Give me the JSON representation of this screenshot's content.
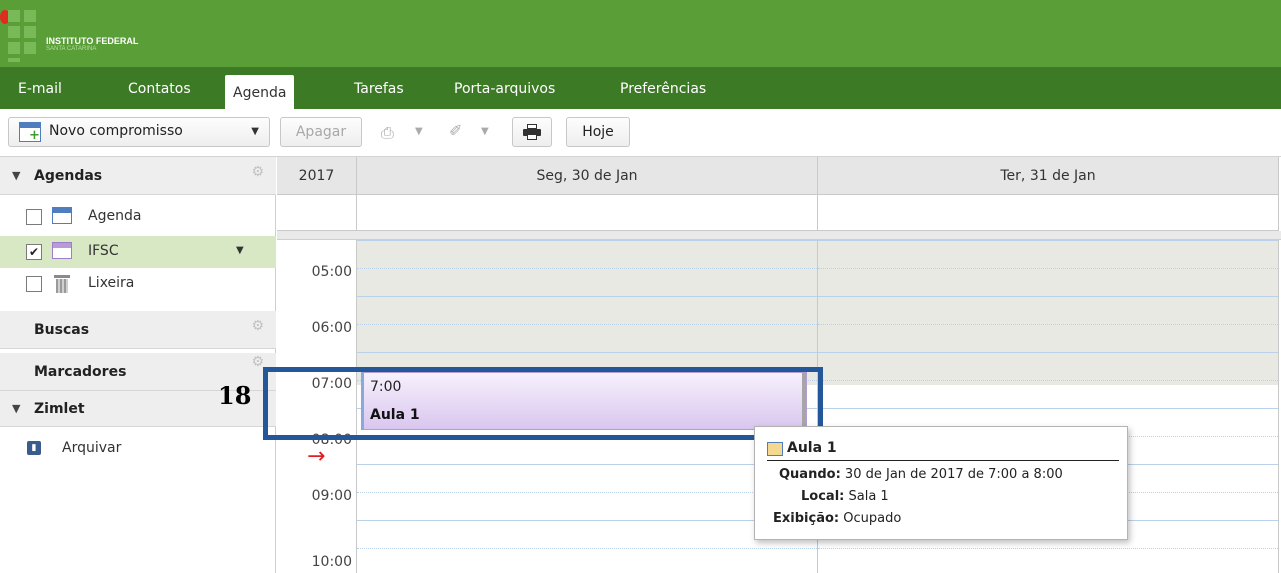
{
  "header": {
    "logo_title": "INSTITUTO FEDERAL",
    "logo_subtitle": "SANTA CATARINA",
    "brand_color": "#5a9e38"
  },
  "tabs": [
    {
      "label": "E-mail"
    },
    {
      "label": "Contatos"
    },
    {
      "label": "Agenda",
      "active": true
    },
    {
      "label": "Tarefas"
    },
    {
      "label": "Porta-arquivos"
    },
    {
      "label": "Preferências"
    }
  ],
  "toolbar": {
    "new_appointment": "Novo compromisso",
    "delete": "Apagar",
    "today": "Hoje"
  },
  "sidebar": {
    "calendars_header": "Agendas",
    "calendars": [
      {
        "label": "Agenda",
        "checked": false,
        "icon": "calendar-icon"
      },
      {
        "label": "IFSC",
        "checked": true,
        "icon": "calendar-icon"
      },
      {
        "label": "Lixeira",
        "checked": false,
        "icon": "trash-icon"
      }
    ],
    "searches_header": "Buscas",
    "tags_header": "Marcadores",
    "zimlet_header": "Zimlet",
    "zimlet_items": [
      {
        "label": "Arquivar"
      }
    ]
  },
  "calendar": {
    "year": "2017",
    "days": [
      "Seg, 30 de Jan",
      "Ter, 31 de Jan"
    ],
    "hours": [
      "05:00",
      "06:00",
      "07:00",
      "08:00",
      "09:00",
      "10:00"
    ],
    "appointment": {
      "time": "7:00",
      "title": "Aula 1"
    }
  },
  "annotation": {
    "number": "18"
  },
  "tooltip": {
    "title": "Aula 1",
    "when_label": "Quando:",
    "when_value": "30 de Jan de 2017 de 7:00 a 8:00",
    "location_label": "Local:",
    "location_value": "Sala 1",
    "display_label": "Exibição:",
    "display_value": "Ocupado"
  }
}
